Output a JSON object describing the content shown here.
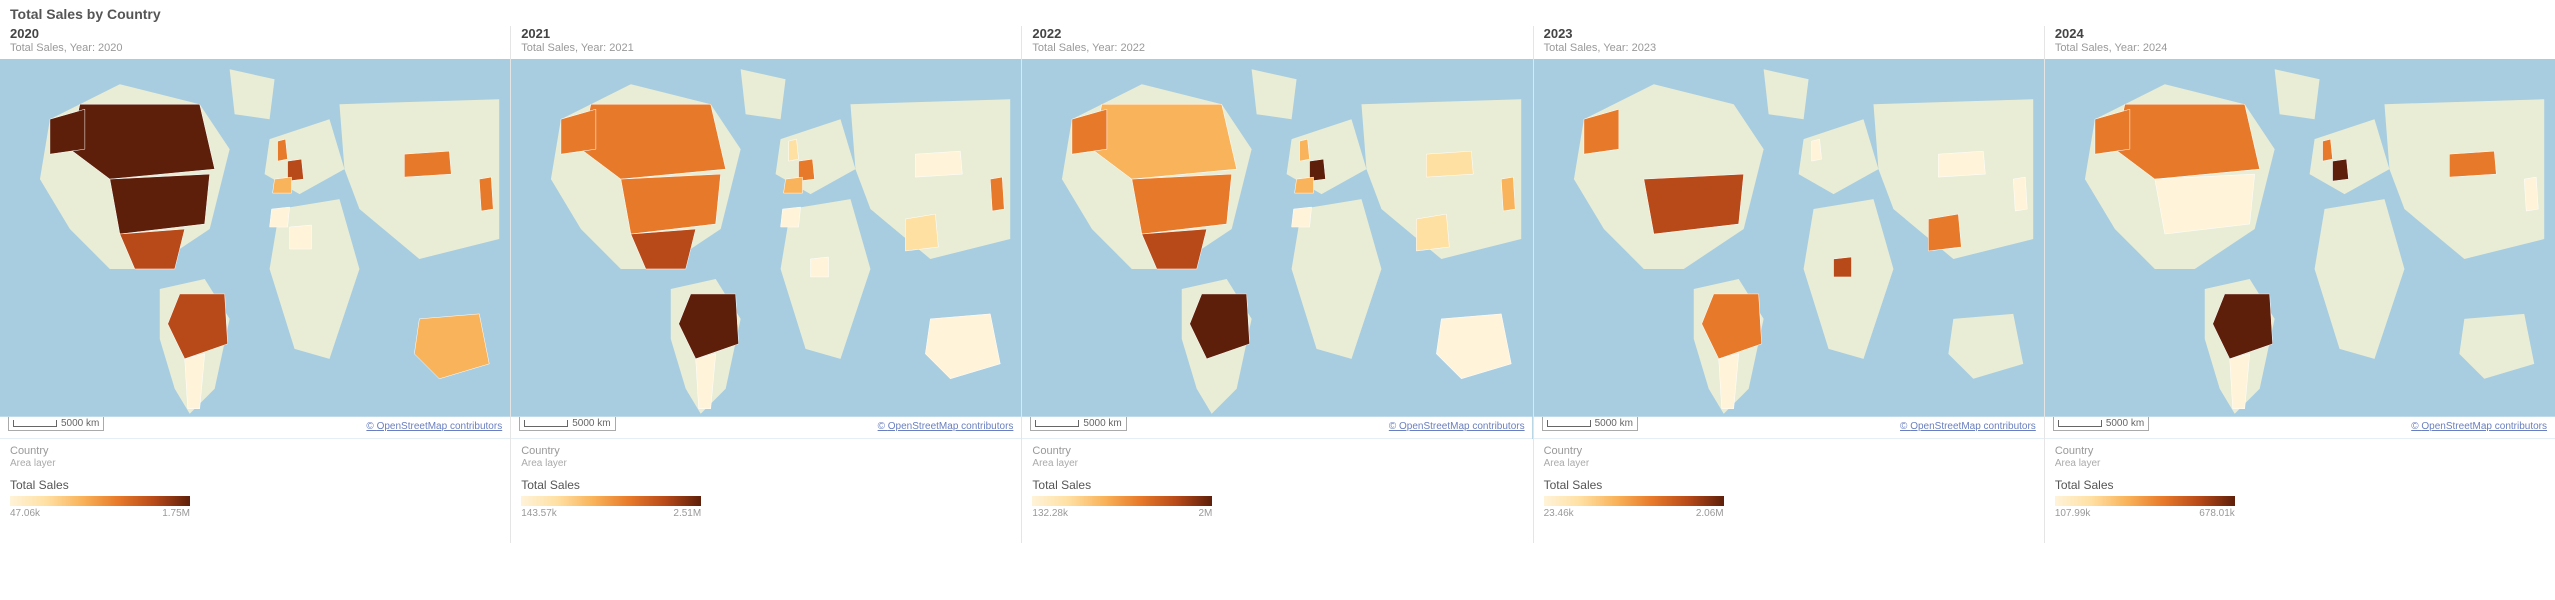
{
  "title": "Total Sales by Country",
  "scalebar_label": "5000 km",
  "attribution_prefix": "© ",
  "attribution_link": "OpenStreetMap contributors",
  "legend": {
    "country_label": "Country",
    "area_label": "Area layer",
    "metric_label": "Total Sales"
  },
  "panels": [
    {
      "year": "2020",
      "subtitle": "Total Sales, Year: 2020",
      "range_min": "47.06k",
      "range_max": "1.75M"
    },
    {
      "year": "2021",
      "subtitle": "Total Sales, Year: 2021",
      "range_min": "143.57k",
      "range_max": "2.51M"
    },
    {
      "year": "2022",
      "subtitle": "Total Sales, Year: 2022",
      "range_min": "132.28k",
      "range_max": "2M"
    },
    {
      "year": "2023",
      "subtitle": "Total Sales, Year: 2023",
      "range_min": "23.46k",
      "range_max": "2.06M"
    },
    {
      "year": "2024",
      "subtitle": "Total Sales, Year: 2024",
      "range_min": "107.99k",
      "range_max": "678.01k"
    }
  ],
  "chart_data": [
    {
      "year": 2020,
      "type": "choropleth",
      "range": [
        47060,
        1750000
      ],
      "countries": {
        "Canada": "d5",
        "USA": "d5",
        "Mexico": "d4",
        "Brazil": "d4",
        "France": "d4",
        "UK": "d3",
        "Spain": "d2",
        "Mongolia": "d3",
        "Japan": "d3",
        "Australia": "d2",
        "Argentina": "d0",
        "Morocco": "d0",
        "Mali": "d0"
      }
    },
    {
      "year": 2021,
      "type": "choropleth",
      "range": [
        143570,
        2510000
      ],
      "countries": {
        "Canada": "d3",
        "USA": "d3",
        "Mexico": "d4",
        "Brazil": "d5",
        "Argentina": "d0",
        "France": "d3",
        "Spain": "d2",
        "UK": "d1",
        "Morocco": "d0",
        "Mongolia": "d0",
        "Japan": "d3",
        "India": "d1",
        "Nigeria": "d0",
        "Australia": "d0"
      }
    },
    {
      "year": 2022,
      "type": "choropleth",
      "range": [
        132280,
        2000000
      ],
      "countries": {
        "Canada": "d2",
        "USA": "d3",
        "Mexico": "d4",
        "Brazil": "d5",
        "France": "d5",
        "UK": "d2",
        "Spain": "d2",
        "India": "d1",
        "Mongolia": "d1",
        "Japan": "d2",
        "Australia": "d0",
        "Morocco": "d0"
      }
    },
    {
      "year": 2023,
      "type": "choropleth",
      "range": [
        23460,
        2060000
      ],
      "countries": {
        "USA": "d4",
        "Brazil": "d3",
        "Argentina": "d0",
        "UK": "d0",
        "Nigeria": "d4",
        "India": "d3",
        "Mongolia": "d0",
        "Japan": "d0"
      }
    },
    {
      "year": 2024,
      "type": "choropleth",
      "range": [
        107990,
        678010
      ],
      "countries": {
        "Canada": "d3",
        "USA": "d0",
        "Brazil": "d5",
        "Argentina": "d0",
        "France": "d5",
        "UK": "d3",
        "Mongolia": "d3",
        "Japan": "d0"
      }
    }
  ]
}
